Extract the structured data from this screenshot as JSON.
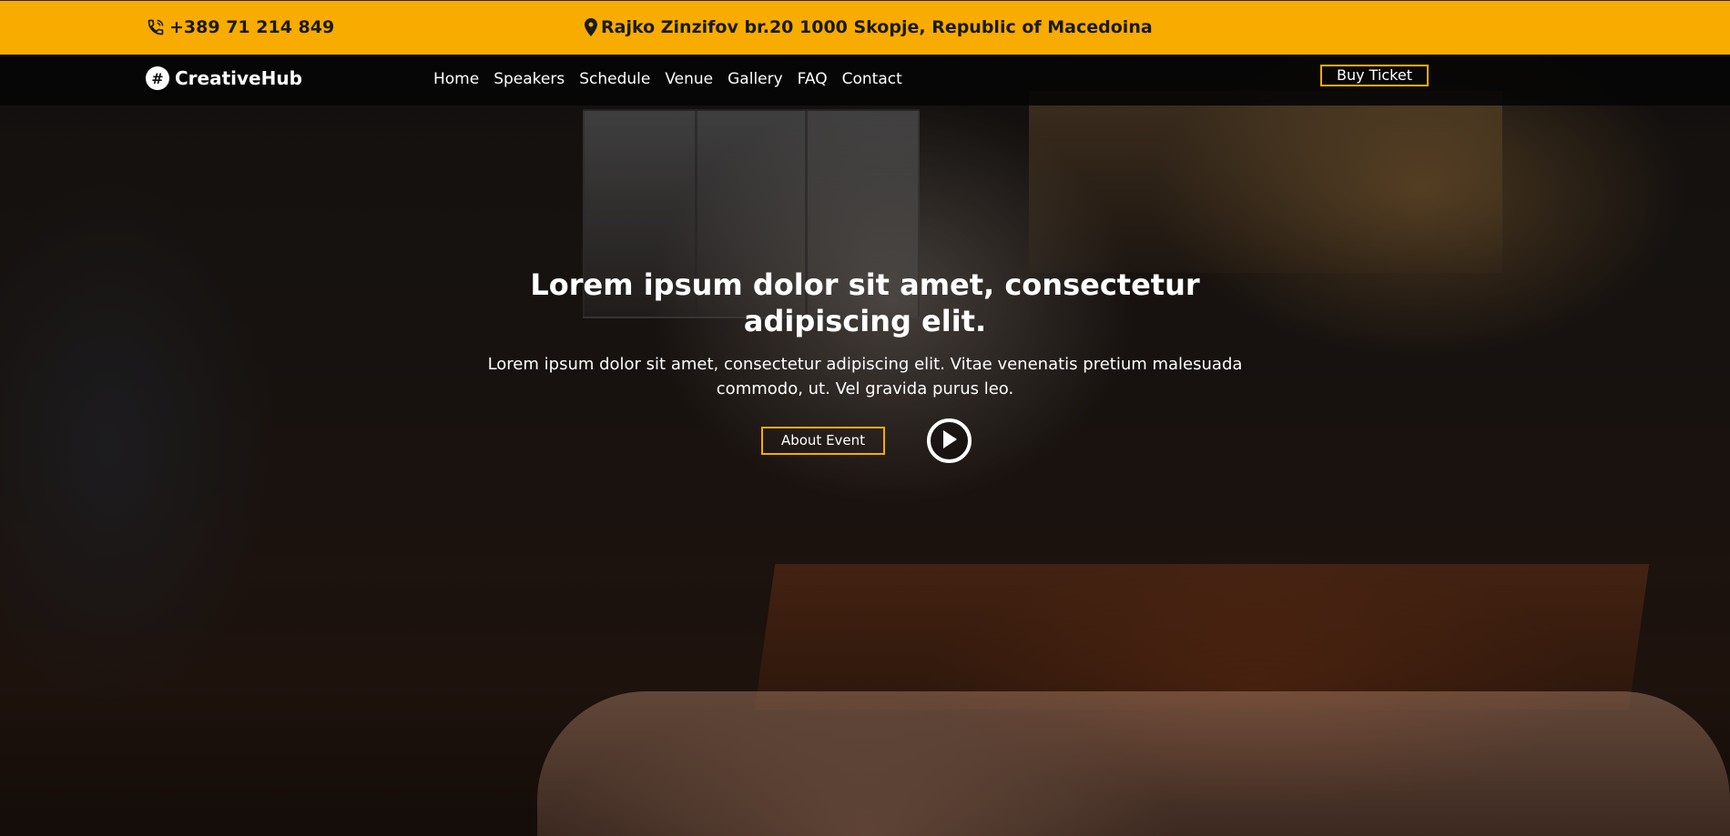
{
  "topbar": {
    "phone": "+389 71 214 849",
    "address": "Rajko Zinzifov br.20 1000 Skopje, Republic of Macedoina",
    "phone_icon": "phone-icon",
    "address_icon": "map-pin-icon",
    "background_color": "#f8ac00"
  },
  "nav": {
    "brand": "CreativeHub",
    "brand_icon": "hashtag-icon",
    "brand_icon_glyph": "#",
    "links": [
      "Home",
      "Speakers",
      "Schedule",
      "Venue",
      "Gallery",
      "FAQ",
      "Contact"
    ],
    "cta": "Buy Ticket",
    "accent_color": "#f8ac00"
  },
  "hero": {
    "title": "Lorem ipsum dolor sit amet, consectetur adipiscing elit.",
    "subtitle": "Lorem ipsum dolor sit amet, consectetur adipiscing elit. Vitae venenatis pretium malesuada commodo, ut. Vel gravida purus leo.",
    "primary_button": "About Event",
    "play_icon": "play-icon",
    "background_image": "photo of a crowd at an event listening to a speaker with a microphone"
  }
}
